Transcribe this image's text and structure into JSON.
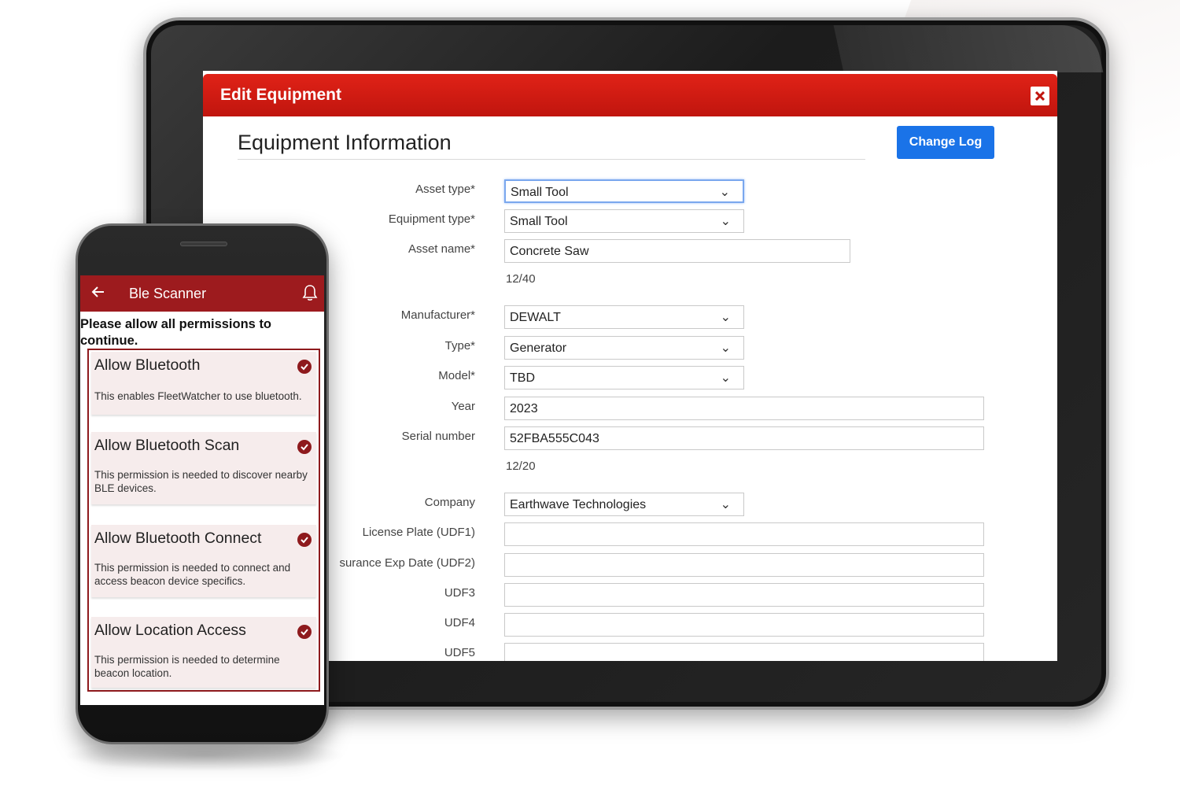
{
  "tablet": {
    "dialog_title": "Edit Equipment",
    "close_icon": "close-x-icon",
    "section_title": "Equipment Information",
    "change_log_label": "Change Log",
    "fields": {
      "asset_type": {
        "label": "Asset type*",
        "value": "Small Tool"
      },
      "equipment_type": {
        "label": "Equipment type*",
        "value": "Small Tool"
      },
      "asset_name": {
        "label": "Asset name*",
        "value": "Concrete Saw",
        "counter": "12/40"
      },
      "manufacturer": {
        "label": "Manufacturer*",
        "value": "DEWALT"
      },
      "type": {
        "label": "Type*",
        "value": "Generator"
      },
      "model": {
        "label": "Model*",
        "value": "TBD"
      },
      "year": {
        "label": "Year",
        "value": "2023"
      },
      "serial_number": {
        "label": "Serial number",
        "value": "52FBA555C043",
        "counter": "12/20"
      },
      "company": {
        "label": "Company",
        "value": "Earthwave Technologies"
      },
      "udf1": {
        "label": "License Plate (UDF1)",
        "value": ""
      },
      "udf2": {
        "label": "surance Exp Date (UDF2)",
        "value": ""
      },
      "udf3": {
        "label": "UDF3",
        "value": ""
      },
      "udf4": {
        "label": "UDF4",
        "value": ""
      },
      "udf5": {
        "label": "UDF5",
        "value": ""
      }
    }
  },
  "phone": {
    "app_title": "Ble Scanner",
    "intro": "Please allow all permissions to continue.",
    "permissions": [
      {
        "title": "Allow Bluetooth",
        "desc": "This enables FleetWatcher to use bluetooth."
      },
      {
        "title": "Allow Bluetooth Scan",
        "desc": "This permission is needed to discover nearby BLE devices."
      },
      {
        "title": "Allow Bluetooth Connect",
        "desc": "This permission is needed to connect and access beacon device specifics."
      },
      {
        "title": "Allow Location Access",
        "desc": "This permission is needed to determine beacon location."
      }
    ]
  },
  "colors": {
    "header_red": "#c0150e",
    "app_bar_red": "#9d1b1e",
    "button_blue": "#1a73e8"
  }
}
